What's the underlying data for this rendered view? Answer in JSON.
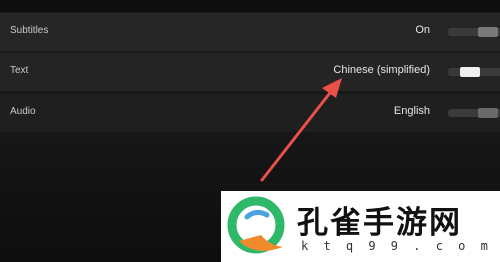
{
  "settings": {
    "subtitles": {
      "label": "Subtitles",
      "value": "On"
    },
    "text": {
      "label": "Text",
      "value": "Chinese (simplified)"
    },
    "audio": {
      "label": "Audio",
      "value": "English"
    }
  },
  "watermark": {
    "title": "孔雀手游网",
    "url": "k t q 9 9 . c o m"
  },
  "colors": {
    "arrow": "#e8504a",
    "background": "#141414",
    "logo_green": "#2fb86a",
    "logo_orange": "#f08a2c"
  }
}
